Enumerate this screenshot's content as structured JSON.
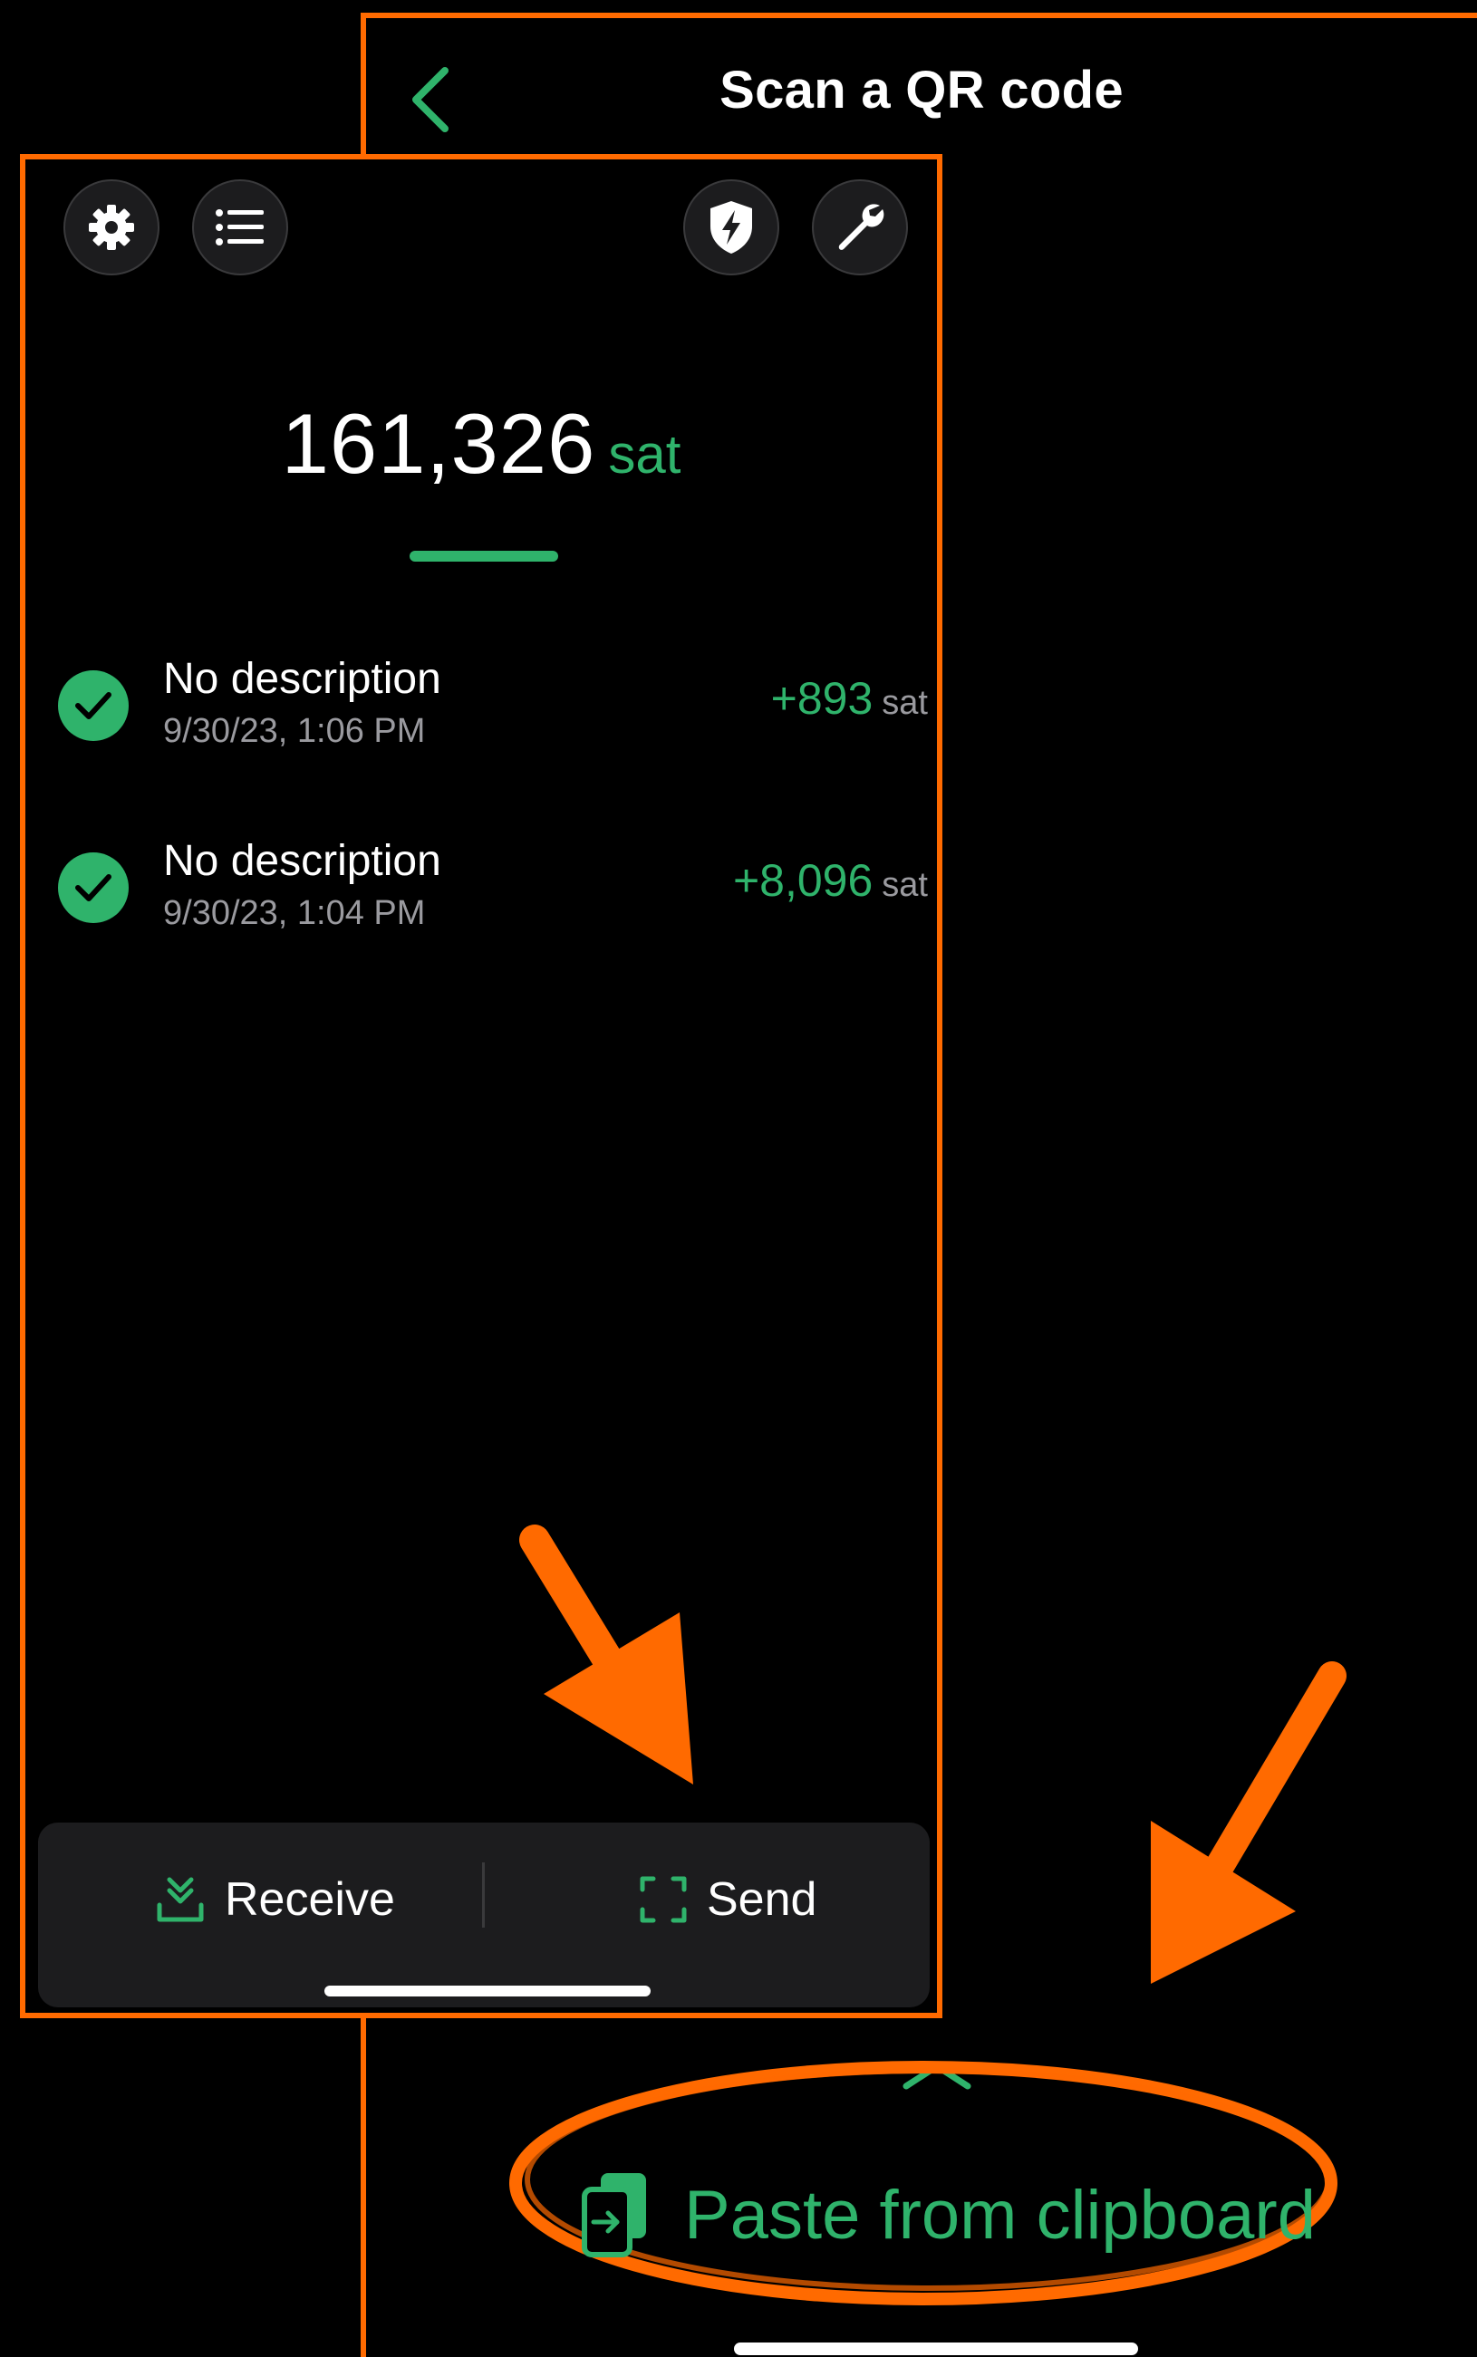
{
  "colors": {
    "accent_green": "#2fb36b",
    "annotation_orange": "#ff6a00",
    "background": "#000000",
    "surface": "#1c1c1e",
    "muted_text": "#9a9a9f"
  },
  "scan_screen": {
    "title": "Scan a QR code",
    "back_icon": "chevron-left-icon",
    "expand_icon": "chevron-up-icon",
    "paste_button": {
      "label": "Paste from clipboard",
      "icon": "clipboard-paste-icon"
    }
  },
  "wallet_screen": {
    "toolbar": {
      "left_icons": [
        "gear-icon",
        "list-icon"
      ],
      "right_icons": [
        "shield-bolt-icon",
        "wrench-icon"
      ]
    },
    "balance": {
      "amount": "161,326",
      "unit": "sat"
    },
    "transactions": [
      {
        "description": "No description",
        "date": "9/30/23, 1:06 PM",
        "amount": "+893",
        "unit": "sat",
        "status_icon": "check-circle-icon"
      },
      {
        "description": "No description",
        "date": "9/30/23, 1:04 PM",
        "amount": "+8,096",
        "unit": "sat",
        "status_icon": "check-circle-icon"
      }
    ],
    "bottom_bar": {
      "receive_label": "Receive",
      "receive_icon": "download-icon",
      "send_label": "Send",
      "send_icon": "scan-frame-icon"
    }
  }
}
